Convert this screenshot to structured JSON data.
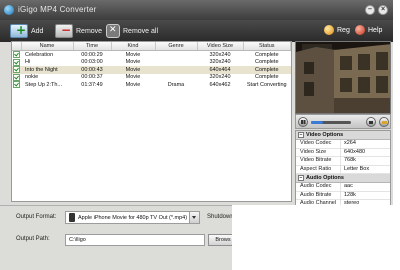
{
  "window": {
    "title": "iGigo MP4 Converter"
  },
  "toolbar": {
    "add_label": "Add",
    "remove_label": "Remove",
    "remove_all_label": "Remove all",
    "reg_label": "Reg",
    "help_label": "Help"
  },
  "filelist": {
    "columns": [
      "Name",
      "Time",
      "Kind",
      "Genre",
      "Video Size",
      "Status"
    ],
    "rows": [
      {
        "name": "Celebration",
        "time": "00:00:29",
        "kind": "Movie",
        "genre": "",
        "size": "320x240",
        "status": "Complete",
        "checked": true
      },
      {
        "name": "Hi",
        "time": "00:03:00",
        "kind": "Movie",
        "genre": "",
        "size": "320x240",
        "status": "Complete",
        "checked": true
      },
      {
        "name": "Into the Night",
        "time": "00:00:43",
        "kind": "Movie",
        "genre": "",
        "size": "640x464",
        "status": "Complete",
        "checked": true
      },
      {
        "name": "nokie",
        "time": "00:00:37",
        "kind": "Movie",
        "genre": "",
        "size": "320x240",
        "status": "Complete",
        "checked": true
      },
      {
        "name": "Step Up 2:Th...",
        "time": "01:37:49",
        "kind": "Movie",
        "genre": "Drama",
        "size": "640x462",
        "status": "Start Converting",
        "checked": true
      }
    ]
  },
  "options": {
    "video_header": "Video Options",
    "video": [
      {
        "key": "Video Codec",
        "value": "x264"
      },
      {
        "key": "Video Size",
        "value": "640x480"
      },
      {
        "key": "Video Bitrate",
        "value": "768k"
      },
      {
        "key": "Aspect Ratio",
        "value": "Letter Box"
      }
    ],
    "audio_header": "Audio Options",
    "audio": [
      {
        "key": "Audio Codec",
        "value": "aac"
      },
      {
        "key": "Audio Bitrate",
        "value": "128k"
      },
      {
        "key": "Audio Channel",
        "value": "stereo"
      }
    ]
  },
  "bottom": {
    "output_format_label": "Output Format:",
    "output_format_value": "Apple iPhone Movie for 480p TV Out (*.mp4)",
    "shutdown_label": "Shutdown",
    "output_path_label": "Output Path:",
    "output_path_value": "C:\\lligo",
    "browse_label": "Brows"
  }
}
